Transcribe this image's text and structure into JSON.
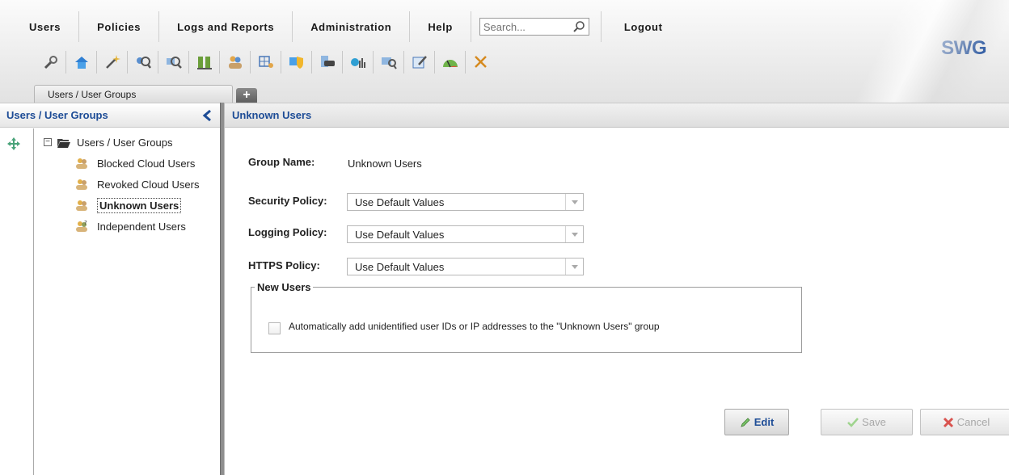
{
  "menu": {
    "items": [
      "Users",
      "Policies",
      "Logs and Reports",
      "Administration",
      "Help"
    ],
    "search_placeholder": "Search...",
    "logout": "Logout"
  },
  "toolbar": {
    "icons": [
      "wrench-icon",
      "home-icon",
      "wand-icon",
      "search-users-icon",
      "search-icon",
      "list-columns-icon",
      "users-icon",
      "grid-users-icon",
      "shield-icon",
      "url-icon",
      "chart-icon",
      "report-search-icon",
      "edit-document-icon",
      "gauge-icon",
      "tools-icon"
    ]
  },
  "brand": "SWG",
  "tabs": {
    "main": "Users / User Groups",
    "add": "+"
  },
  "left_panel": {
    "title": "Users / User Groups",
    "tree": {
      "root": "Users / User Groups",
      "children": [
        {
          "label": "Blocked Cloud Users",
          "selected": false
        },
        {
          "label": "Revoked Cloud Users",
          "selected": false
        },
        {
          "label": "Unknown Users",
          "selected": true
        },
        {
          "label": "Independent Users",
          "selected": false
        }
      ]
    }
  },
  "right_panel": {
    "title": "Unknown Users",
    "group_name_label": "Group Name:",
    "group_name_value": "Unknown Users",
    "security_label": "Security Policy:",
    "security_value": "Use Default Values",
    "logging_label": "Logging Policy:",
    "logging_value": "Use Default Values",
    "https_label": "HTTPS Policy:",
    "https_value": "Use Default Values",
    "new_users_legend": "New Users",
    "auto_add_label": "Automatically add unidentified user IDs or IP addresses to the \"Unknown Users\" group",
    "auto_add_checked": false
  },
  "buttons": {
    "edit": "Edit",
    "save": "Save",
    "cancel": "Cancel"
  },
  "colors": {
    "accent": "#1d4c96",
    "disabled": "#a8a8a8",
    "cancel_icon": "#c0392b",
    "save_icon": "#7cc56b"
  }
}
